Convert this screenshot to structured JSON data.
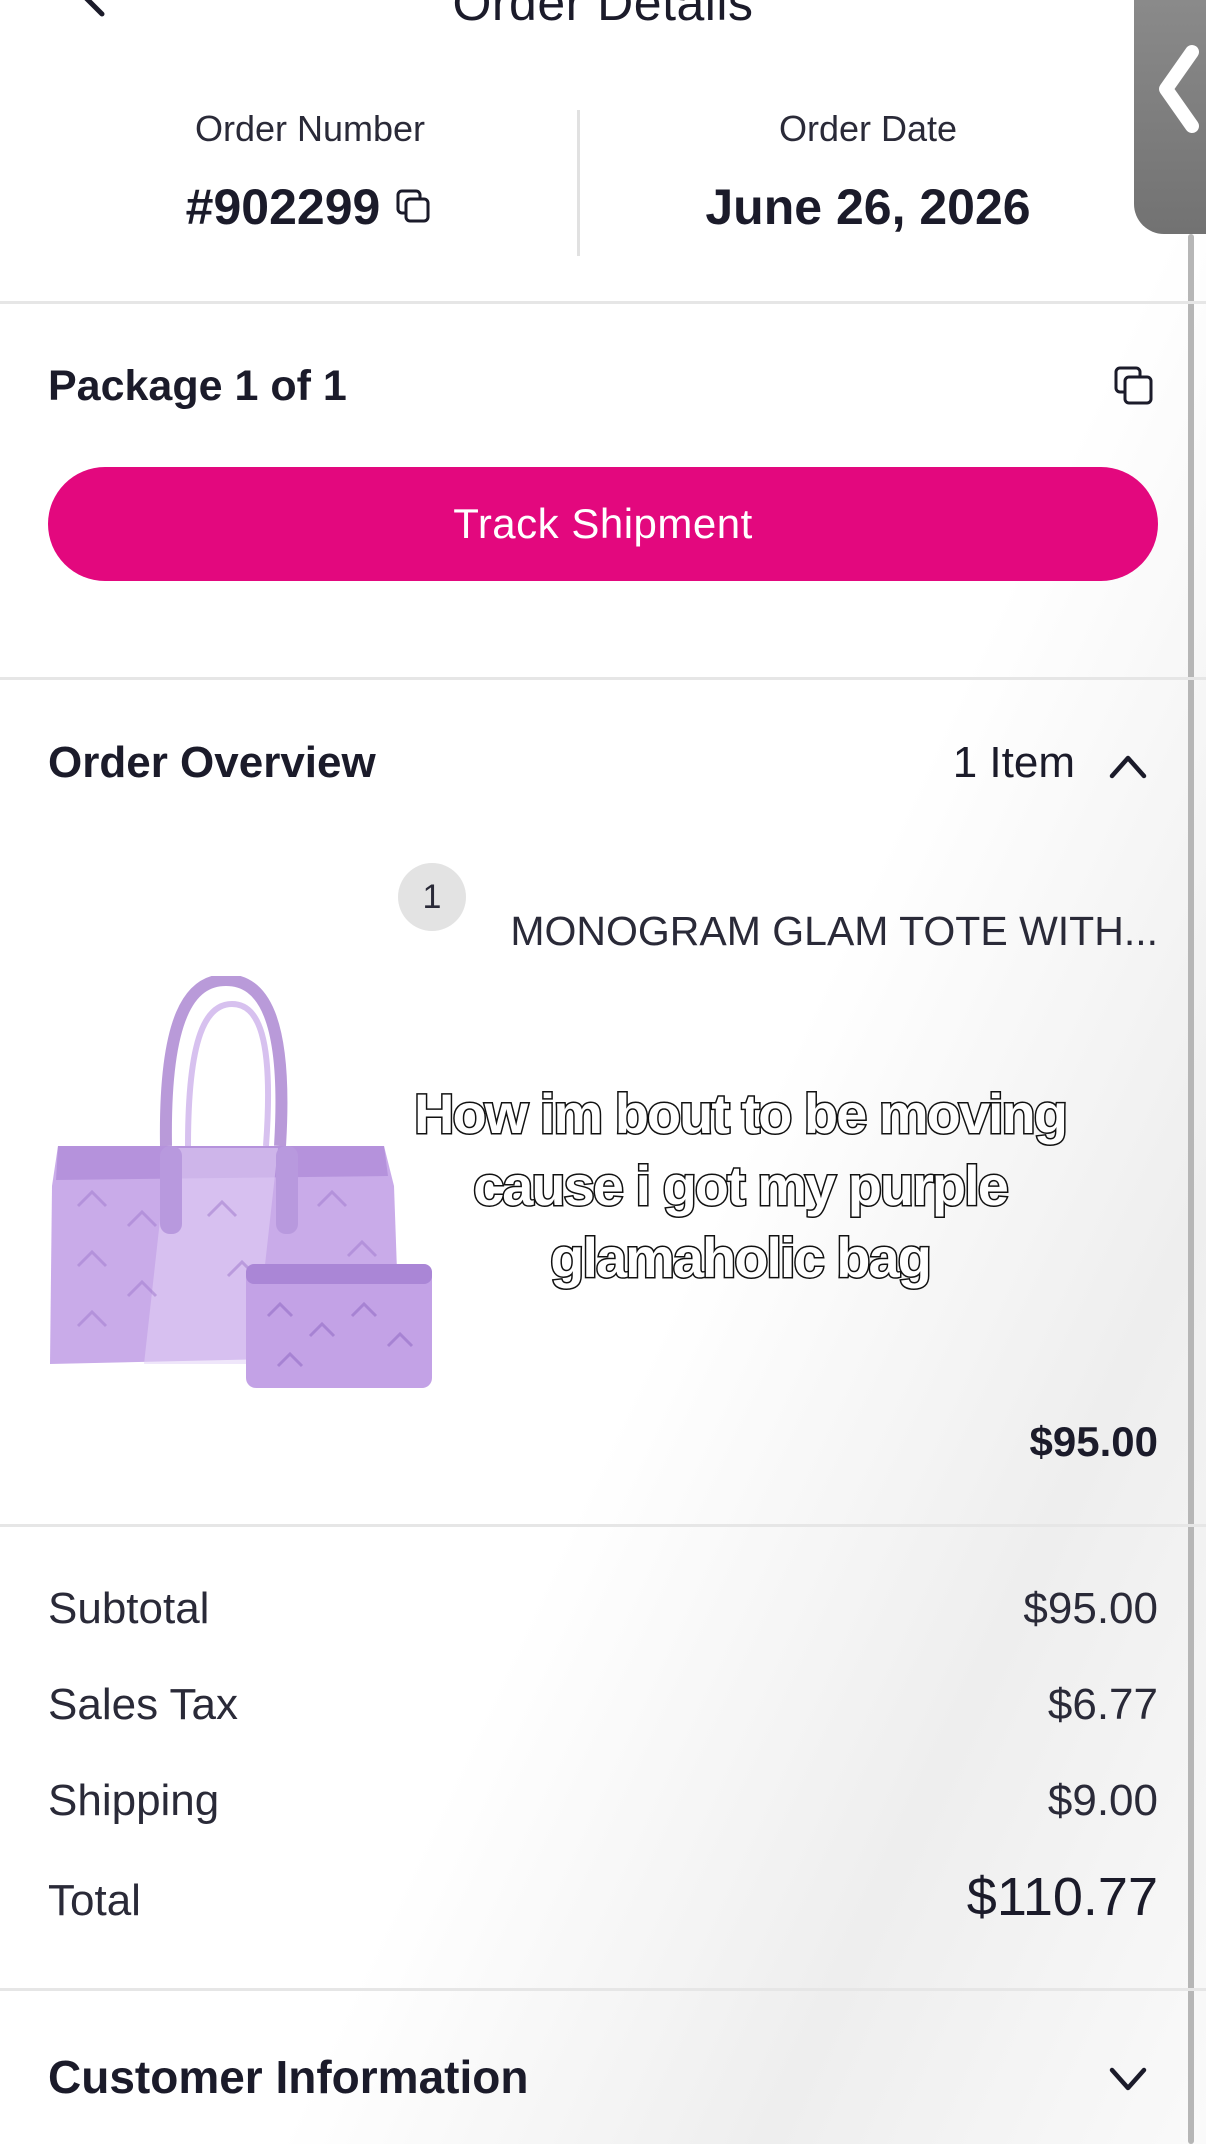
{
  "header": {
    "title": "Order Details"
  },
  "order": {
    "number_label": "Order Number",
    "number": "#902299",
    "date_label": "Order Date",
    "date": "June 26, 2026"
  },
  "package": {
    "label": "Package 1 of 1",
    "track_button": "Track Shipment"
  },
  "overview": {
    "title": "Order Overview",
    "item_count": "1 Item",
    "items": [
      {
        "quantity": "1",
        "name": "MONOGRAM GLAM TOTE WITH...",
        "price": "$95.00",
        "image": "purple-monogram-tote-with-pouch"
      }
    ],
    "caption": "How im bout to be moving cause i got my purple glamaholic bag"
  },
  "summary": {
    "subtotal_label": "Subtotal",
    "subtotal": "$95.00",
    "tax_label": "Sales Tax",
    "tax": "$6.77",
    "shipping_label": "Shipping",
    "shipping": "$9.00",
    "total_label": "Total",
    "total": "$110.77"
  },
  "customer": {
    "title": "Customer Information"
  },
  "colors": {
    "accent": "#e3087e",
    "text": "#1b1b2a",
    "divider": "#e6e6e6",
    "side_tab": "#7d7d7d",
    "product": "#c6a6e6"
  },
  "icons": [
    "back-arrow-icon",
    "copy-icon",
    "chevron-up-icon",
    "chevron-down-icon",
    "side-tab-chevron-icon"
  ]
}
